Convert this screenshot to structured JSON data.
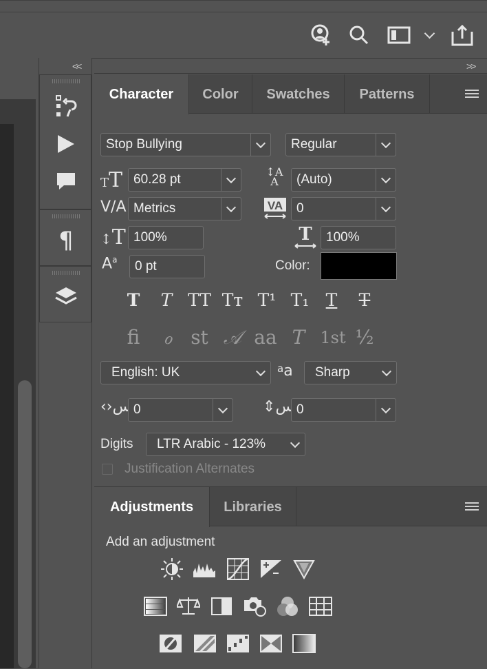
{
  "character_panel": {
    "tabs": [
      "Character",
      "Color",
      "Swatches",
      "Patterns"
    ],
    "font_family": "Stop Bullying",
    "font_style": "Regular",
    "font_size": "60.28 pt",
    "leading": "(Auto)",
    "kerning": "Metrics",
    "tracking": "0",
    "vertical_scale": "100%",
    "horizontal_scale": "100%",
    "baseline_shift": "0 pt",
    "color_label": "Color:",
    "color_value": "#000000",
    "language": "English: UK",
    "antialias": "Sharp",
    "arabic_spacing_1": "0",
    "arabic_spacing_2": "0",
    "digits_label": "Digits",
    "digits_value": "LTR Arabic - 123%",
    "justification_label": "Justification Alternates",
    "style_buttons": [
      "T",
      "T",
      "TT",
      "Tт",
      "T¹",
      "T₁",
      "T",
      "T"
    ],
    "opentype_buttons": [
      "ﬁ",
      "ℴ",
      "st",
      "𝒜",
      "aa",
      "T",
      "1st",
      "½"
    ]
  },
  "adjustments_panel": {
    "tabs": [
      "Adjustments",
      "Libraries"
    ],
    "heading": "Add an adjustment",
    "icons_row1": [
      "brightness-icon",
      "levels-icon",
      "curves-icon",
      "exposure-icon",
      "vibrance-icon"
    ],
    "icons_row2": [
      "hue-saturation-icon",
      "color-balance-icon",
      "black-white-icon",
      "photo-filter-icon",
      "channel-mixer-icon",
      "color-lookup-icon"
    ],
    "icons_row3": [
      "invert-icon",
      "posterize-icon",
      "threshold-icon",
      "selective-color-icon",
      "gradient-map-icon"
    ]
  },
  "toolbar": {
    "icons": [
      "share-user-icon",
      "search-icon",
      "workspace-icon",
      "chevron-down-icon",
      "export-icon"
    ]
  },
  "colors": {
    "panel_bg": "#535353",
    "tab_bg": "#474747",
    "text": "#e8e8e8"
  }
}
